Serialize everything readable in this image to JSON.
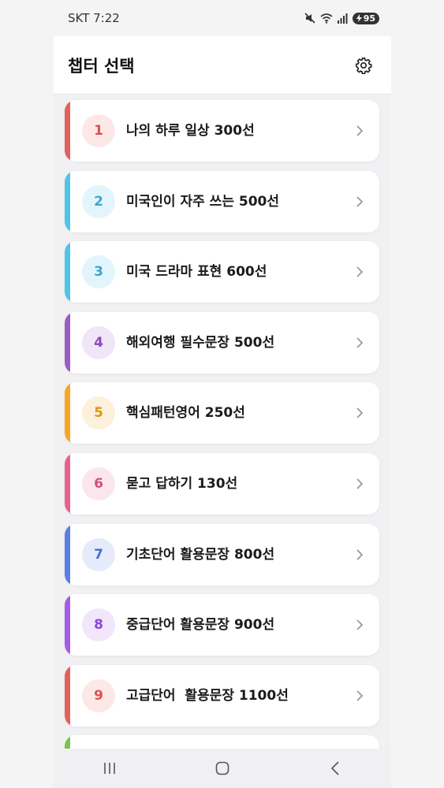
{
  "status": {
    "carrier_time": "SKT 7:22",
    "battery": "95"
  },
  "header": {
    "title": "챕터 선택"
  },
  "chapters": [
    {
      "num": "1",
      "title": "나의 하루 일상 300선",
      "accent": "#e2615b",
      "circle_bg": "#fde8e8",
      "num_color": "#d9534f"
    },
    {
      "num": "2",
      "title": "미국인이 자주 쓰는 500선",
      "accent": "#4fc3e8",
      "circle_bg": "#e3f5fc",
      "num_color": "#3aa6cf"
    },
    {
      "num": "3",
      "title": "미국 드라마 표현 600선",
      "accent": "#4fc3e8",
      "circle_bg": "#e3f5fc",
      "num_color": "#3aa6cf"
    },
    {
      "num": "4",
      "title": "해외여행 필수문장 500선",
      "accent": "#9a5bc4",
      "circle_bg": "#f0e6f7",
      "num_color": "#8a4bb8"
    },
    {
      "num": "5",
      "title": "핵심패턴영어 250선",
      "accent": "#f6a623",
      "circle_bg": "#fdf1dc",
      "num_color": "#e09415"
    },
    {
      "num": "6",
      "title": "묻고 답하기 130선",
      "accent": "#e8618c",
      "circle_bg": "#fce6ee",
      "num_color": "#d4507c"
    },
    {
      "num": "7",
      "title": "기초단어 활용문장 800선",
      "accent": "#5b7de8",
      "circle_bg": "#e6ebfb",
      "num_color": "#4b6bd4"
    },
    {
      "num": "8",
      "title": "중급단어 활용문장 900선",
      "accent": "#a35be8",
      "circle_bg": "#f1e6fc",
      "num_color": "#8e47d6"
    },
    {
      "num": "9",
      "title": "고급단어  활용문장 1100선",
      "accent": "#e2615b",
      "circle_bg": "#fde8e8",
      "num_color": "#d9534f"
    }
  ],
  "partial_card": {
    "accent": "#7bc44a"
  },
  "icons": {
    "settings": "gear-icon",
    "chevron": "chevron-right-icon",
    "nav_recents": "recents-icon",
    "nav_home": "home-icon",
    "nav_back": "back-icon"
  }
}
